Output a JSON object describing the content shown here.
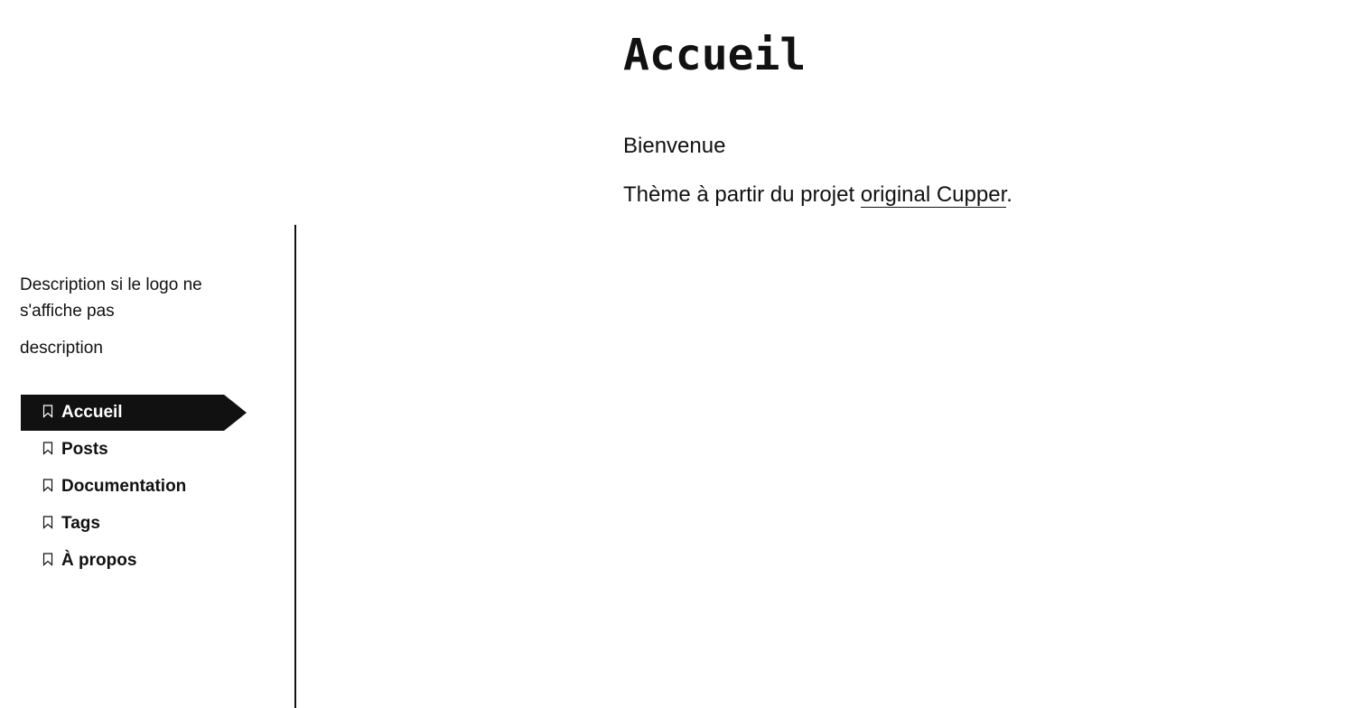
{
  "main": {
    "title": "Accueil",
    "welcome": "Bienvenue",
    "intro_before": "Thème à partir du projet ",
    "intro_link": "original Cupper",
    "intro_after": "."
  },
  "sidebar": {
    "logo_alt": "Description si le logo ne s'affiche pas",
    "description": "description",
    "nav": [
      {
        "label": "Accueil",
        "icon": "bookmark-icon",
        "active": true
      },
      {
        "label": "Posts",
        "icon": "bookmark-icon",
        "active": false
      },
      {
        "label": "Documentation",
        "icon": "bookmark-icon",
        "active": false
      },
      {
        "label": "Tags",
        "icon": "bookmark-icon",
        "active": false
      },
      {
        "label": "À propos",
        "icon": "bookmark-icon",
        "active": false
      }
    ]
  },
  "colors": {
    "text": "#111111",
    "background": "#ffffff",
    "active_nav_bg": "#111111",
    "active_nav_text": "#ffffff"
  }
}
